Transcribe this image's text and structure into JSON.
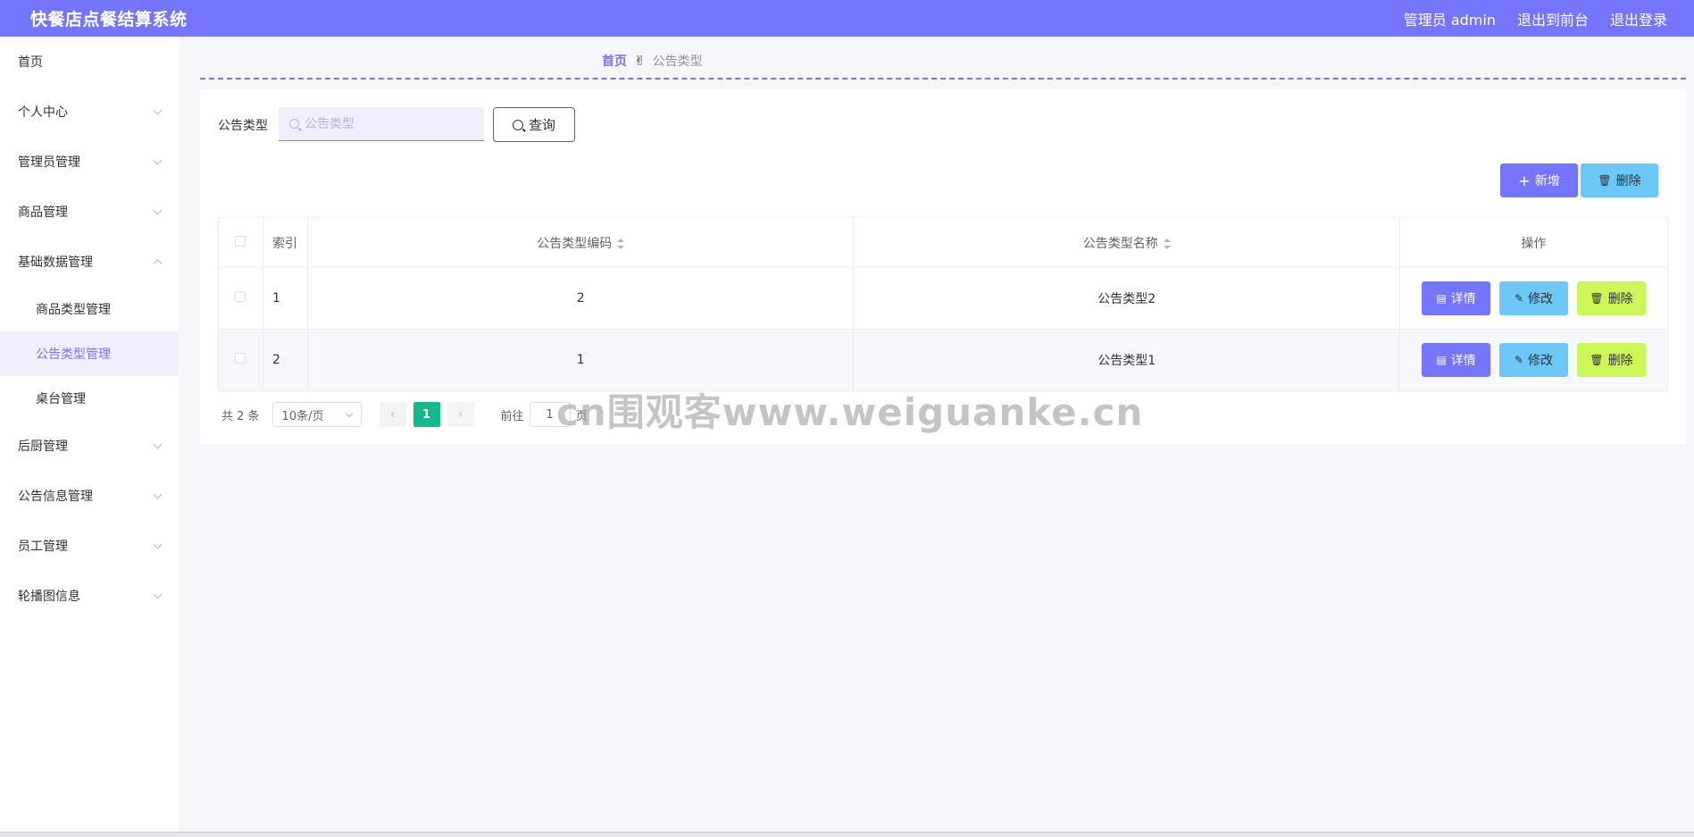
{
  "header": {
    "title": "快餐店点餐结算系统",
    "user": "管理员 admin",
    "front": "退出到前台",
    "logout": "退出登录"
  },
  "sidebar": {
    "items": [
      {
        "label": "首页"
      },
      {
        "label": "个人中心"
      },
      {
        "label": "管理员管理"
      },
      {
        "label": "商品管理"
      },
      {
        "label": "基础数据管理"
      },
      {
        "label": "后厨管理"
      },
      {
        "label": "公告信息管理"
      },
      {
        "label": "员工管理"
      },
      {
        "label": "轮播图信息"
      }
    ],
    "subitems": [
      {
        "label": "商品类型管理"
      },
      {
        "label": "公告类型管理"
      },
      {
        "label": "桌台管理"
      }
    ]
  },
  "breadcrumb": {
    "home": "首页",
    "separator": "✌",
    "current": "公告类型"
  },
  "search": {
    "label": "公告类型",
    "placeholder": "公告类型",
    "query": "查询"
  },
  "toolbar": {
    "add": "新增",
    "delete": "删除"
  },
  "table": {
    "headers": {
      "index": "索引",
      "code": "公告类型编码",
      "name": "公告类型名称",
      "ops": "操作"
    },
    "rows": [
      {
        "index": "1",
        "code": "2",
        "name": "公告类型2"
      },
      {
        "index": "2",
        "code": "1",
        "name": "公告类型1"
      }
    ],
    "actions": {
      "detail": "详情",
      "edit": "修改",
      "delete": "删除"
    }
  },
  "pagination": {
    "total": "共 2 条",
    "page_size": "10条/页",
    "prev": "‹",
    "current": "1",
    "next": "›",
    "goto": "前往",
    "goto_value": "1",
    "page_suffix": "页"
  },
  "watermark": "cn围观客www.weiguanke.cn",
  "colors": {
    "primary": "#7575fb",
    "info": "#6ec8f7",
    "lime": "#cdf758",
    "page_active": "#13b98c"
  }
}
